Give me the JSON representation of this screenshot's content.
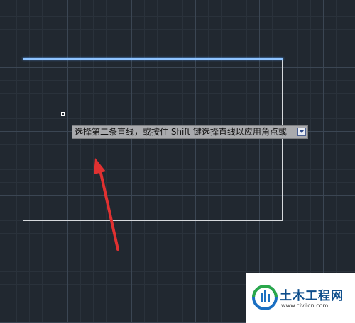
{
  "prompt": {
    "text": "选择第二条直线，或按住 Shift 键选择直线以应用角点或",
    "dropdown_icon": "down-arrow-icon"
  },
  "watermark": {
    "title": "土木工程网",
    "url": "www.civilcn.com",
    "icon": "civilcn-logo-icon"
  },
  "colors": {
    "background": "#212830",
    "grid_major": "#3b4653",
    "grid_minor": "#2a323b",
    "rectangle": "#d6d9dc",
    "selected_edge": "#8fc4ff",
    "tooltip_bg": "#a9aaad",
    "annotation_arrow": "#e03131"
  }
}
